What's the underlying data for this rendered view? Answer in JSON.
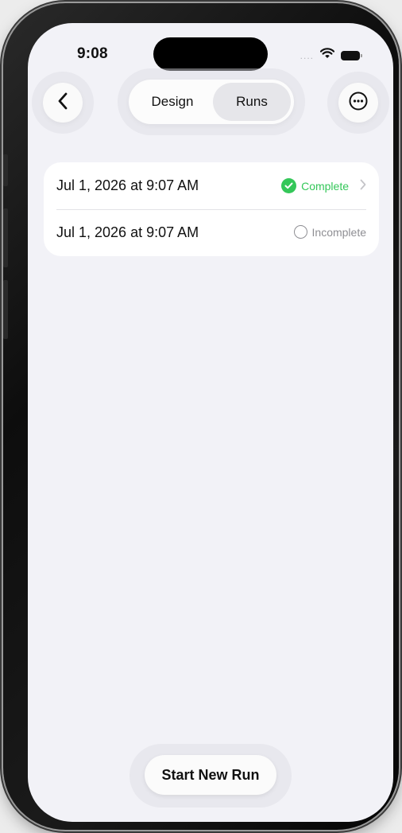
{
  "status_bar": {
    "time": "9:08",
    "signal_dots": "....",
    "icons": [
      "wifi-icon",
      "battery-icon"
    ]
  },
  "nav": {
    "back_icon": "chevron-left-icon",
    "more_icon": "ellipsis-circle-icon",
    "segments": [
      {
        "label": "Design",
        "selected": false
      },
      {
        "label": "Runs",
        "selected": true
      }
    ]
  },
  "runs": [
    {
      "date": "Jul 1, 2026 at 9:07 AM",
      "status": "Complete",
      "status_icon": "checkmark-circle-icon",
      "status_color": "#34c759",
      "has_chevron": true
    },
    {
      "date": "Jul 1, 2026 at 9:07 AM",
      "status": "Incomplete",
      "status_icon": "empty-circle-icon",
      "status_color": "#8e8e93",
      "has_chevron": false
    }
  ],
  "start_button": {
    "label": "Start New Run"
  },
  "colors": {
    "background": "#f2f2f7",
    "card": "#ffffff",
    "accent_green": "#34c759",
    "secondary_text": "#8e8e93"
  }
}
